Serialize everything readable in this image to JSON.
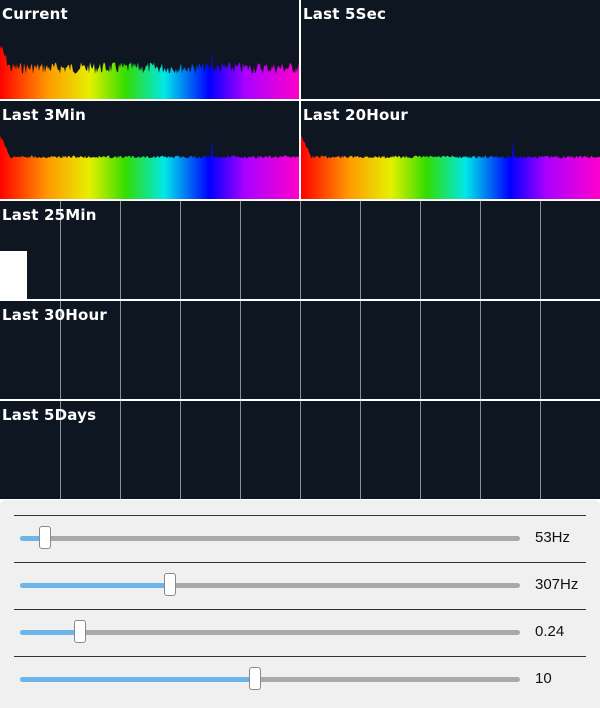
{
  "panels": {
    "current": {
      "title": "Current"
    },
    "last5sec": {
      "title": "Last 5Sec"
    },
    "last3min": {
      "title": "Last 3Min"
    },
    "last20hour": {
      "title": "Last 20Hour"
    },
    "last25min": {
      "title": "Last 25Min"
    },
    "last30hour": {
      "title": "Last 30Hour"
    },
    "last5days": {
      "title": "Last 5Days"
    }
  },
  "sliders": [
    {
      "value": 0.05,
      "label": "53Hz"
    },
    {
      "value": 0.3,
      "label": "307Hz"
    },
    {
      "value": 0.12,
      "label": "0.24"
    },
    {
      "value": 0.47,
      "label": "10"
    }
  ],
  "colors": {
    "panel_bg": "#0e1622",
    "controls_bg": "#f0f0f0",
    "slider_fill": "#6cb4ea",
    "slider_track": "#a9a9a9"
  }
}
